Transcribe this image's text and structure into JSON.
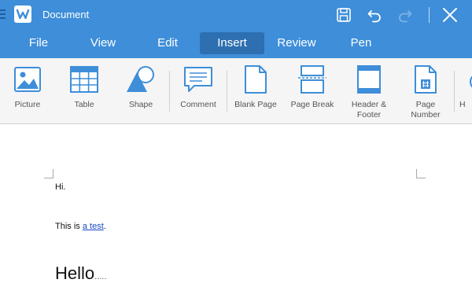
{
  "titlebar": {
    "title": "Document",
    "app_logo_letter": "W",
    "colors": {
      "bar": "#3e8ed9",
      "menu_active": "#2d6fb0"
    },
    "buttons": {
      "save_icon": "save-icon",
      "undo_icon": "undo-icon",
      "redo_icon": "redo-icon",
      "close_icon": "close-icon"
    }
  },
  "menu": {
    "tabs": [
      {
        "label": "File"
      },
      {
        "label": "View"
      },
      {
        "label": "Edit"
      },
      {
        "label": "Insert",
        "active": true
      },
      {
        "label": "Review"
      },
      {
        "label": "Pen"
      }
    ]
  },
  "ribbon": {
    "items": [
      {
        "label": "Picture",
        "icon": "picture-icon"
      },
      {
        "label": "Table",
        "icon": "table-icon"
      },
      {
        "label": "Shape",
        "icon": "shape-icon"
      },
      {
        "label": "Comment",
        "icon": "comment-icon"
      },
      {
        "label": "Blank Page",
        "icon": "blank-page-icon"
      },
      {
        "label": "Page Break",
        "icon": "page-break-icon"
      },
      {
        "label": "Header &\nFooter",
        "icon": "header-footer-icon"
      },
      {
        "label": "Page\nNumber",
        "icon": "page-number-icon"
      },
      {
        "label": "H",
        "icon": "hyperlink-icon"
      }
    ]
  },
  "document": {
    "line1": "Hi.",
    "line2_prefix": "This is ",
    "line2_link": "a test",
    "line2_suffix": ".",
    "heading": "Hello",
    "heading_trailing": "....."
  }
}
